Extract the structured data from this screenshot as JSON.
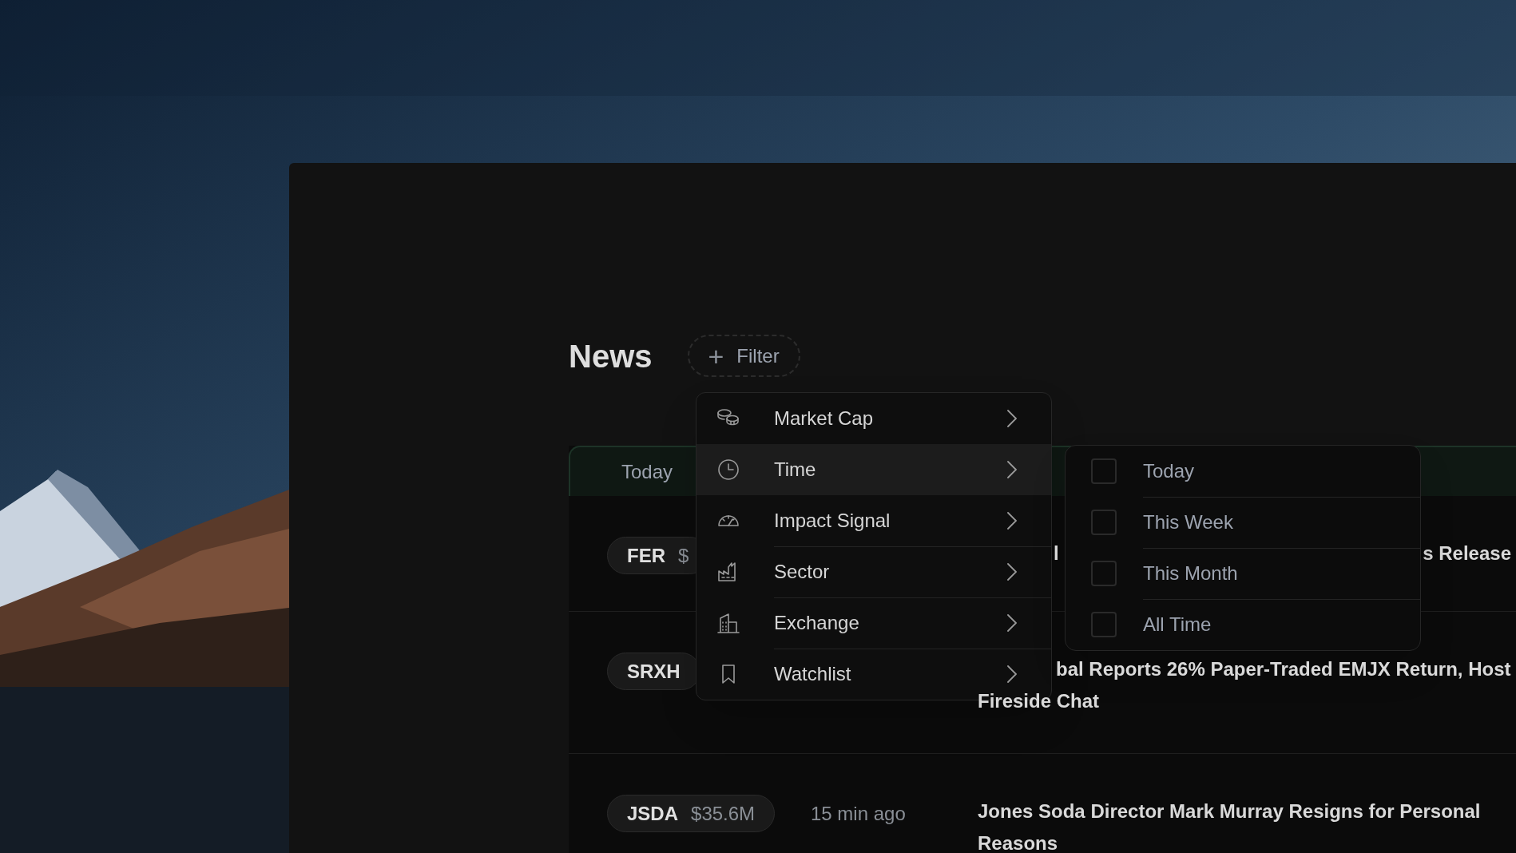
{
  "page": {
    "title": "News"
  },
  "filter_button": {
    "icon": "+",
    "label": "Filter"
  },
  "filter_menu": [
    {
      "kind": "coins",
      "label": "Market Cap",
      "selected": false
    },
    {
      "kind": "clock",
      "label": "Time",
      "selected": true
    },
    {
      "kind": "gauge",
      "label": "Impact Signal",
      "selected": false
    },
    {
      "kind": "factory",
      "label": "Sector",
      "selected": false
    },
    {
      "kind": "building",
      "label": "Exchange",
      "selected": false
    },
    {
      "kind": "bookmark",
      "label": "Watchlist",
      "selected": false
    }
  ],
  "time_submenu": [
    {
      "label": "Today",
      "checked": false
    },
    {
      "label": "This Week",
      "checked": false
    },
    {
      "label": "This Month",
      "checked": false
    },
    {
      "label": "All Time",
      "checked": false
    }
  ],
  "table": {
    "header": "Today",
    "rows": [
      {
        "ticker": "FER",
        "market_cap": "$",
        "headline_parts": [
          "l",
          "s Release"
        ]
      },
      {
        "ticker": "SRXH",
        "headline_lines": [
          "bal Reports 26% Paper-Traded EMJX Return, Host",
          "Fireside Chat"
        ]
      },
      {
        "ticker": "JSDA",
        "market_cap": "$35.6M",
        "time": "15 min ago",
        "headline_lines": [
          "Jones Soda Director Mark Murray Resigns for Personal",
          "Reasons"
        ]
      }
    ]
  }
}
